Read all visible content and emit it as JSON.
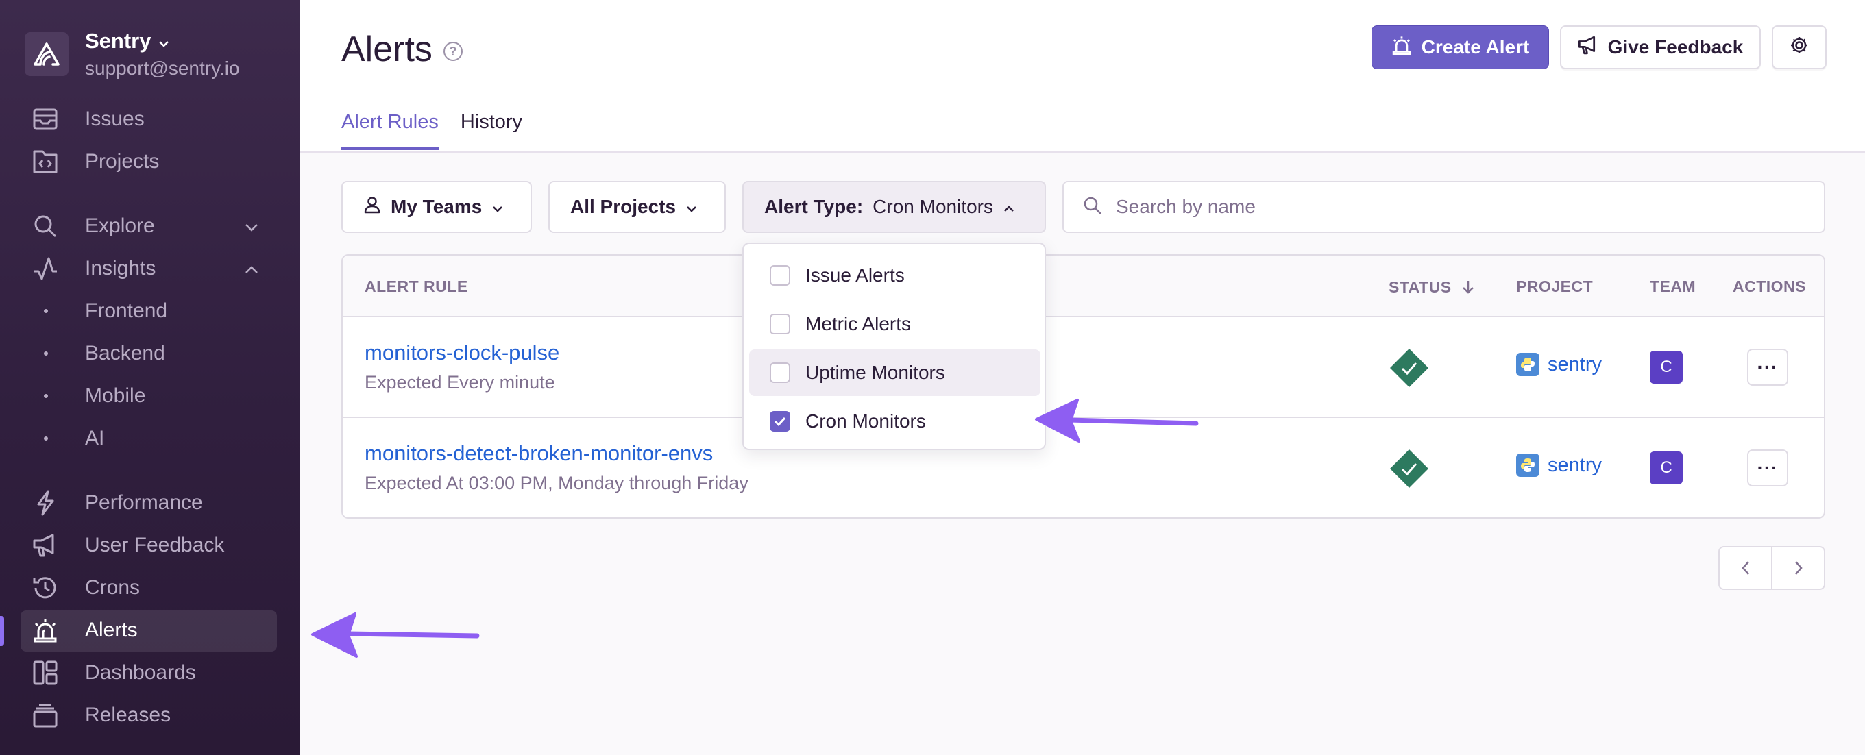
{
  "colors": {
    "accent": "#6c5fc7",
    "link": "#2562d4",
    "status_ok": "#2d7a5f",
    "team_badge": "#5b3fc4",
    "annotation_arrow": "#8e5ef2"
  },
  "sidebar": {
    "org_name": "Sentry",
    "org_email": "support@sentry.io",
    "items": [
      {
        "label": "Issues",
        "icon": "inbox-icon"
      },
      {
        "label": "Projects",
        "icon": "code-icon"
      },
      {
        "label": "Explore",
        "icon": "search-icon"
      },
      {
        "label": "Insights",
        "icon": "graph-icon"
      },
      {
        "label": "Performance",
        "icon": "lightning-icon"
      },
      {
        "label": "User Feedback",
        "icon": "megaphone-icon"
      },
      {
        "label": "Crons",
        "icon": "timer-icon"
      },
      {
        "label": "Alerts",
        "icon": "siren-icon"
      },
      {
        "label": "Dashboards",
        "icon": "dashboard-icon"
      },
      {
        "label": "Releases",
        "icon": "releases-icon"
      }
    ],
    "insights_sub": [
      "Frontend",
      "Backend",
      "Mobile",
      "AI"
    ],
    "active": "Alerts"
  },
  "header": {
    "title": "Alerts",
    "create_alert": "Create Alert",
    "give_feedback": "Give Feedback",
    "tabs": [
      {
        "label": "Alert Rules",
        "active": true
      },
      {
        "label": "History",
        "active": false
      }
    ]
  },
  "filters": {
    "teams": "My Teams",
    "projects": "All Projects",
    "alert_type_label": "Alert Type:",
    "alert_type_value": "Cron Monitors",
    "search_placeholder": "Search by name"
  },
  "dropdown": {
    "options": [
      {
        "label": "Issue Alerts",
        "checked": false
      },
      {
        "label": "Metric Alerts",
        "checked": false
      },
      {
        "label": "Uptime Monitors",
        "checked": false
      },
      {
        "label": "Cron Monitors",
        "checked": true
      }
    ]
  },
  "table": {
    "columns": {
      "rule": "ALERT RULE",
      "status": "STATUS",
      "project": "PROJECT",
      "team": "TEAM",
      "actions": "ACTIONS"
    },
    "rows": [
      {
        "name": "monitors-clock-pulse",
        "schedule": "Expected Every minute",
        "status": "ok",
        "project": "sentry",
        "team": "C",
        "actions": "···"
      },
      {
        "name": "monitors-detect-broken-monitor-envs",
        "schedule": "Expected At 03:00 PM, Monday through Friday",
        "status": "ok",
        "project": "sentry",
        "team": "C",
        "actions": "···"
      }
    ]
  }
}
